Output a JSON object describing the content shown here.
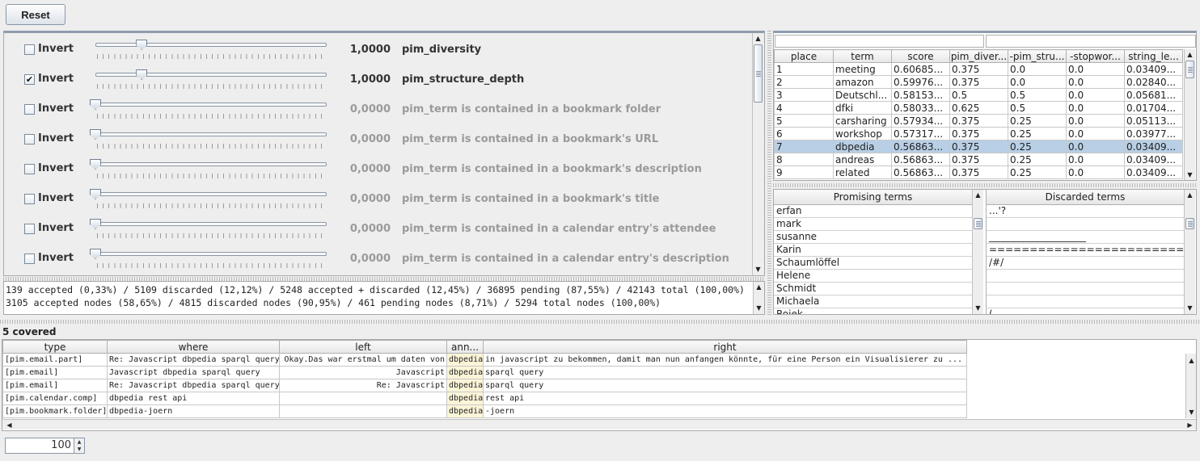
{
  "toolbar": {
    "reset_label": "Reset"
  },
  "features": [
    {
      "checked": false,
      "invert_label": "Invert",
      "value": "1,0000",
      "name": "pim_diversity",
      "active": true,
      "slider": 0.2
    },
    {
      "checked": true,
      "invert_label": "Invert",
      "value": "1,0000",
      "name": "pim_structure_depth",
      "active": true,
      "slider": 0.2
    },
    {
      "checked": false,
      "invert_label": "Invert",
      "value": "0,0000",
      "name": "pim_term is contained in a bookmark folder",
      "active": false,
      "slider": 0
    },
    {
      "checked": false,
      "invert_label": "Invert",
      "value": "0,0000",
      "name": "pim_term is contained in a bookmark's URL",
      "active": false,
      "slider": 0
    },
    {
      "checked": false,
      "invert_label": "Invert",
      "value": "0,0000",
      "name": "pim_term is contained in a bookmark's description",
      "active": false,
      "slider": 0
    },
    {
      "checked": false,
      "invert_label": "Invert",
      "value": "0,0000",
      "name": "pim_term is contained in a bookmark's title",
      "active": false,
      "slider": 0
    },
    {
      "checked": false,
      "invert_label": "Invert",
      "value": "0,0000",
      "name": "pim_term is contained in a calendar entry's attendee",
      "active": false,
      "slider": 0
    },
    {
      "checked": false,
      "invert_label": "Invert",
      "value": "0,0000",
      "name": "pim_term is contained in a calendar entry's description",
      "active": false,
      "slider": 0
    }
  ],
  "stats": {
    "line1": "139 accepted (0,33%) / 5109 discarded (12,12%) / 5248 accepted + discarded (12,45%) / 36895 pending (87,55%) / 42143 total (100,00%)",
    "line2": "3105 accepted nodes (58,65%) / 4815 discarded nodes (90,95%) / 461 pending nodes (8,71%) / 5294 total nodes (100,00%)"
  },
  "ranking": {
    "columns": [
      "place",
      "term",
      "score",
      "pim_diver...",
      "-pim_stru...",
      "-stopwor...",
      "string_le..."
    ],
    "selected_row": 6,
    "rows": [
      [
        "1",
        "meeting",
        "0.60685...",
        "0.375",
        "0.0",
        "0.0",
        "0.03409..."
      ],
      [
        "2",
        "amazon",
        "0.59976...",
        "0.375",
        "0.0",
        "0.0",
        "0.02840..."
      ],
      [
        "3",
        "Deutschl...",
        "0.58153...",
        "0.5",
        "0.5",
        "0.0",
        "0.05681..."
      ],
      [
        "4",
        "dfki",
        "0.58033...",
        "0.625",
        "0.5",
        "0.0",
        "0.01704..."
      ],
      [
        "5",
        "carsharing",
        "0.57934...",
        "0.375",
        "0.25",
        "0.0",
        "0.05113..."
      ],
      [
        "6",
        "workshop",
        "0.57317...",
        "0.375",
        "0.25",
        "0.0",
        "0.03977..."
      ],
      [
        "7",
        "dbpedia",
        "0.56863...",
        "0.375",
        "0.25",
        "0.0",
        "0.03409..."
      ],
      [
        "8",
        "andreas",
        "0.56863...",
        "0.375",
        "0.25",
        "0.0",
        "0.03409..."
      ],
      [
        "9",
        "related",
        "0.56863...",
        "0.375",
        "0.25",
        "0.0",
        "0.03409..."
      ]
    ]
  },
  "promising": {
    "header": "Promising terms",
    "items": [
      "erfan",
      "mark",
      "susanne",
      "Karin",
      "Schaumlöffel",
      "Helene",
      "Schmidt",
      "Michaela",
      "Rojek"
    ]
  },
  "discarded": {
    "header": "Discarded terms",
    "items": [
      "...'?",
      "",
      "____________________",
      "=========================",
      "/#/",
      "",
      "",
      "",
      "("
    ]
  },
  "covered": {
    "label": "5 covered",
    "columns": [
      "type",
      "where",
      "left",
      "ann...",
      "right"
    ],
    "rows": [
      [
        "[pim.email.part]",
        "Re: Javascript dbpedia sparql query",
        "Okay.Das war erstmal um daten von",
        "dbpedia",
        "in javascript zu bekommen, damit man nun anfangen könnte, für eine Person ein Visualisierer zu ..."
      ],
      [
        "[pim.email]",
        "Javascript dbpedia sparql query",
        "Javascript",
        "dbpedia",
        "sparql query"
      ],
      [
        "[pim.email]",
        "Re: Javascript dbpedia sparql query",
        "Re: Javascript",
        "dbpedia",
        "sparql query"
      ],
      [
        "[pim.calendar.comp]",
        "dbpedia rest api",
        "",
        "dbpedia",
        "rest api"
      ],
      [
        "[pim.bookmark.folder]",
        "dbpedia-joern",
        "",
        "dbpedia",
        "-joern"
      ]
    ]
  },
  "spinner": {
    "value": "100"
  }
}
